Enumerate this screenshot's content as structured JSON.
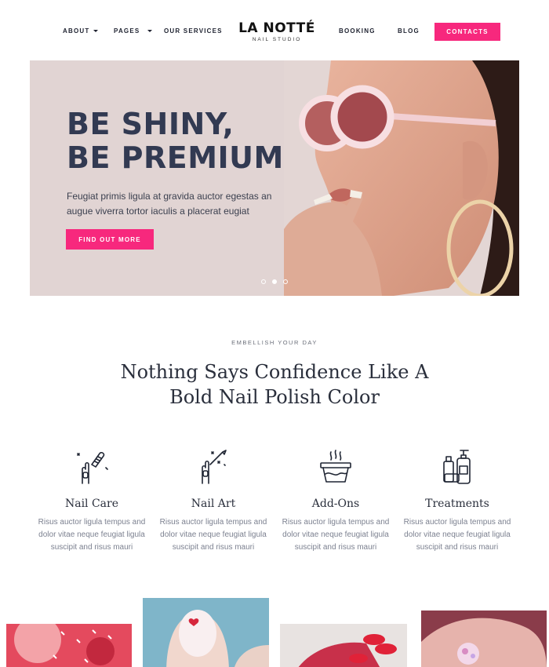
{
  "nav": {
    "about": "About",
    "pages": "Pages",
    "services": "Our Services",
    "booking": "Booking",
    "blog": "Blog",
    "contacts": "Contacts"
  },
  "logo": {
    "name": "LA NOTTÉ",
    "tagline": "NAIL STUDIO"
  },
  "hero": {
    "title": "BE SHINY,\nBE PREMIUM",
    "text": "Feugiat primis ligula at gravida auctor egestas an augue viverra tortor iaculis a placerat eugiat",
    "button": "Find out more"
  },
  "section": {
    "eyebrow": "Embellish your day",
    "headline": "Nothing Says Confidence Like A\nBold Nail Polish Color"
  },
  "services": [
    {
      "title": "Nail Care",
      "desc": "Risus auctor ligula tempus and dolor vitae neque feugiat ligula suscipit and risus mauri",
      "icon": "nail-file-icon"
    },
    {
      "title": "Nail Art",
      "desc": "Risus auctor ligula tempus and dolor vitae neque feugiat ligula suscipit and risus mauri",
      "icon": "nail-brush-icon"
    },
    {
      "title": "Add-Ons",
      "desc": "Risus auctor ligula tempus and dolor vitae neque feugiat ligula suscipit and risus mauri",
      "icon": "bowl-icon"
    },
    {
      "title": "Treatments",
      "desc": "Risus auctor ligula tempus and dolor vitae neque feugiat ligula suscipit and risus mauri",
      "icon": "bottles-icon"
    }
  ],
  "colors": {
    "accent": "#f7287d",
    "heading": "#323a52",
    "hero_bg": "#e1d4d3"
  }
}
